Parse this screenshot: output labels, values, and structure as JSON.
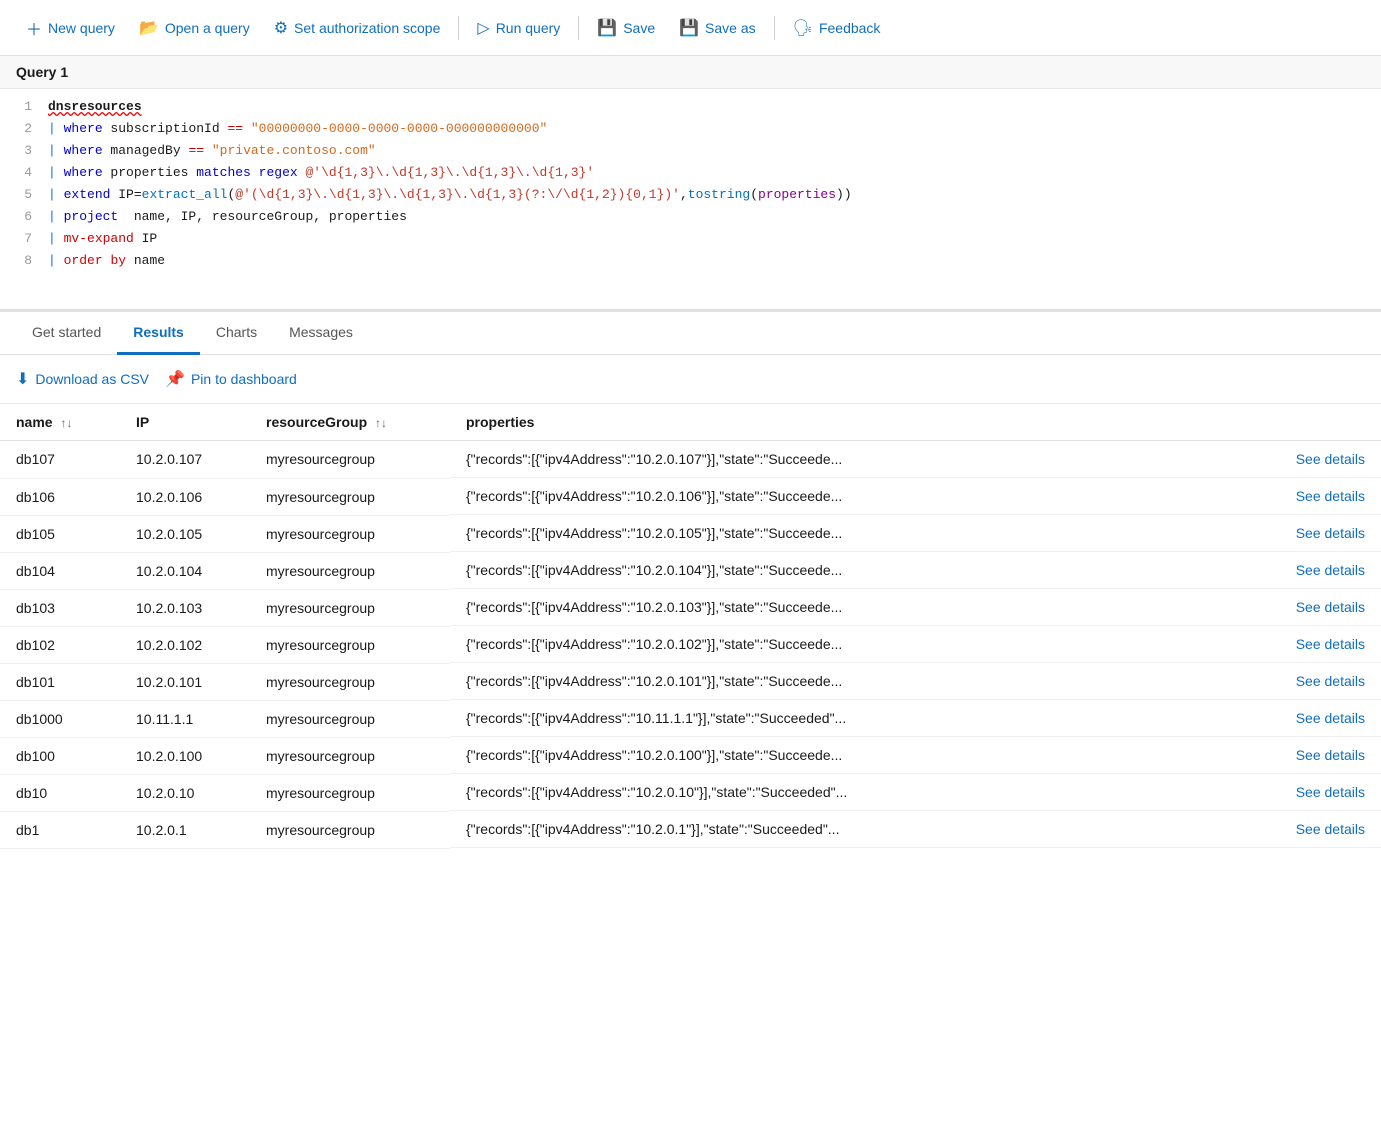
{
  "toolbar": {
    "new_query_label": "New query",
    "open_query_label": "Open a query",
    "set_auth_label": "Set authorization scope",
    "run_query_label": "Run query",
    "save_label": "Save",
    "save_as_label": "Save as",
    "feedback_label": "Feedback"
  },
  "query": {
    "title": "Query 1",
    "lines": [
      {
        "num": "1",
        "content": "dnsresources"
      },
      {
        "num": "2",
        "content": "| where subscriptionId == \"00000000-0000-0000-0000-000000000000\""
      },
      {
        "num": "3",
        "content": "| where managedBy == \"private.contoso.com\""
      },
      {
        "num": "4",
        "content": "| where properties matches regex @'\\d{1,3}\\.\\d{1,3}\\.\\d{1,3}\\.\\d{1,3}'"
      },
      {
        "num": "5",
        "content": "| extend IP=extract_all(@'(\\d{1,3}\\.\\d{1,3}\\.\\d{1,3}\\.\\d{1,3}(?:\\/\\d{1,2}){0,1})',tostring(properties))"
      },
      {
        "num": "6",
        "content": "| project  name, IP, resourceGroup, properties"
      },
      {
        "num": "7",
        "content": "| mv-expand IP"
      },
      {
        "num": "8",
        "content": "| order by name"
      }
    ]
  },
  "tabs": {
    "get_started": "Get started",
    "results": "Results",
    "charts": "Charts",
    "messages": "Messages"
  },
  "actions": {
    "download_csv": "Download as CSV",
    "pin_to_dashboard": "Pin to dashboard"
  },
  "table": {
    "columns": [
      {
        "key": "name",
        "label": "name",
        "sortable": true
      },
      {
        "key": "ip",
        "label": "IP",
        "sortable": false
      },
      {
        "key": "resourceGroup",
        "label": "resourceGroup",
        "sortable": true
      },
      {
        "key": "properties",
        "label": "properties",
        "sortable": false
      }
    ],
    "rows": [
      {
        "name": "db107",
        "ip": "10.2.0.107",
        "resourceGroup": "myresourcegroup",
        "properties": "{\"records\":[{\"ipv4Address\":\"10.2.0.107\"}],\"state\":\"Succeede..."
      },
      {
        "name": "db106",
        "ip": "10.2.0.106",
        "resourceGroup": "myresourcegroup",
        "properties": "{\"records\":[{\"ipv4Address\":\"10.2.0.106\"}],\"state\":\"Succeede..."
      },
      {
        "name": "db105",
        "ip": "10.2.0.105",
        "resourceGroup": "myresourcegroup",
        "properties": "{\"records\":[{\"ipv4Address\":\"10.2.0.105\"}],\"state\":\"Succeede..."
      },
      {
        "name": "db104",
        "ip": "10.2.0.104",
        "resourceGroup": "myresourcegroup",
        "properties": "{\"records\":[{\"ipv4Address\":\"10.2.0.104\"}],\"state\":\"Succeede..."
      },
      {
        "name": "db103",
        "ip": "10.2.0.103",
        "resourceGroup": "myresourcegroup",
        "properties": "{\"records\":[{\"ipv4Address\":\"10.2.0.103\"}],\"state\":\"Succeede..."
      },
      {
        "name": "db102",
        "ip": "10.2.0.102",
        "resourceGroup": "myresourcegroup",
        "properties": "{\"records\":[{\"ipv4Address\":\"10.2.0.102\"}],\"state\":\"Succeede..."
      },
      {
        "name": "db101",
        "ip": "10.2.0.101",
        "resourceGroup": "myresourcegroup",
        "properties": "{\"records\":[{\"ipv4Address\":\"10.2.0.101\"}],\"state\":\"Succeede..."
      },
      {
        "name": "db1000",
        "ip": "10.11.1.1",
        "resourceGroup": "myresourcegroup",
        "properties": "{\"records\":[{\"ipv4Address\":\"10.11.1.1\"}],\"state\":\"Succeeded\"..."
      },
      {
        "name": "db100",
        "ip": "10.2.0.100",
        "resourceGroup": "myresourcegroup",
        "properties": "{\"records\":[{\"ipv4Address\":\"10.2.0.100\"}],\"state\":\"Succeede..."
      },
      {
        "name": "db10",
        "ip": "10.2.0.10",
        "resourceGroup": "myresourcegroup",
        "properties": "{\"records\":[{\"ipv4Address\":\"10.2.0.10\"}],\"state\":\"Succeeded\"..."
      },
      {
        "name": "db1",
        "ip": "10.2.0.1",
        "resourceGroup": "myresourcegroup",
        "properties": "{\"records\":[{\"ipv4Address\":\"10.2.0.1\"}],\"state\":\"Succeeded\"..."
      }
    ],
    "see_details_label": "See details"
  }
}
